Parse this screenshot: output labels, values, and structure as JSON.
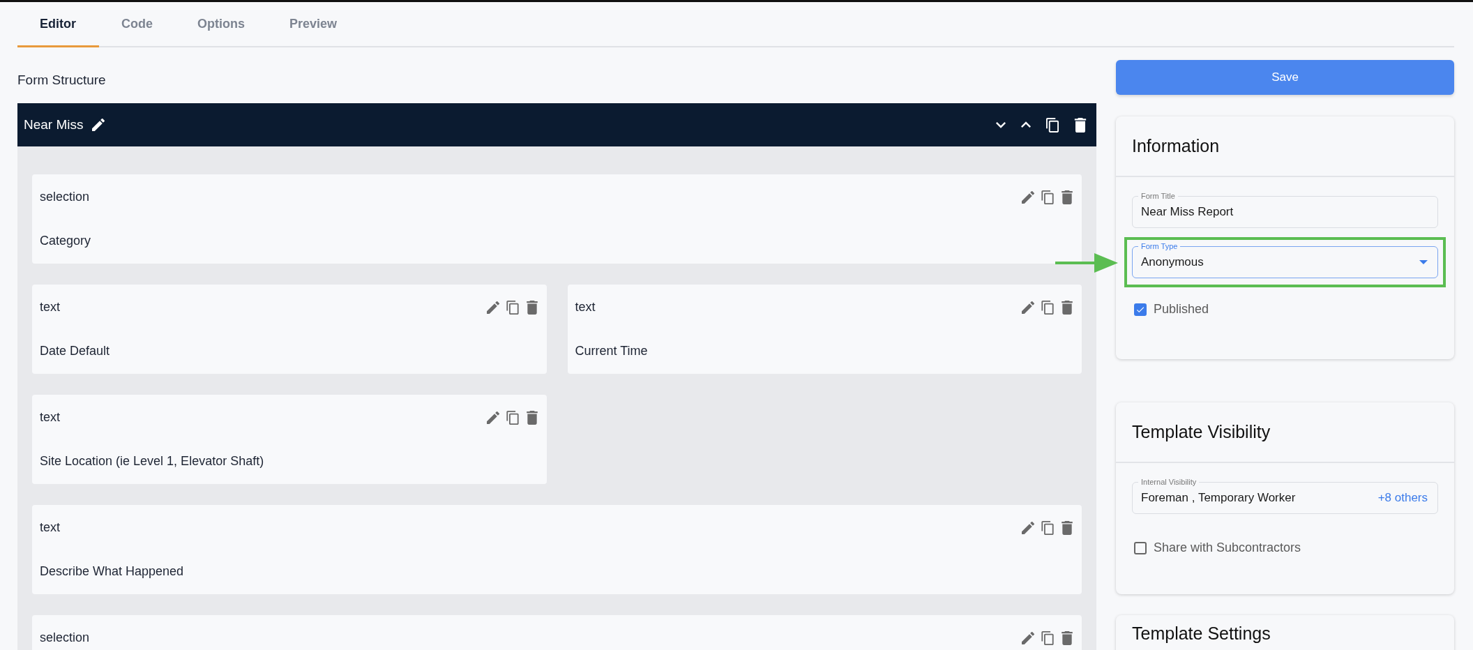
{
  "tabs": [
    {
      "label": "Editor",
      "selected": true
    },
    {
      "label": "Code",
      "selected": false
    },
    {
      "label": "Options",
      "selected": false
    },
    {
      "label": "Preview",
      "selected": false
    }
  ],
  "form_structure": {
    "title": "Form Structure",
    "section": {
      "name": "Near Miss",
      "fields": [
        {
          "type": "selection",
          "label": "Category",
          "kind": "wide"
        },
        {
          "type": "text",
          "label": "Date Default",
          "kind": "narrow"
        },
        {
          "type": "text",
          "label": "Current Time",
          "kind": "narrow"
        },
        {
          "type": "text",
          "label": "Site Location (ie Level 1, Elevator Shaft)",
          "kind": "narrow"
        },
        {
          "type": "text",
          "label": "Describe What Happened",
          "kind": "wide"
        },
        {
          "type": "selection",
          "kind": "wide"
        }
      ]
    }
  },
  "save_button": "Save",
  "information": {
    "title": "Information",
    "form_title": {
      "label": "Form Title",
      "value": "Near Miss Report"
    },
    "form_type": {
      "label": "Form Type",
      "value": "Anonymous",
      "focused": true,
      "highlighted": true
    },
    "published": {
      "label": "Published",
      "checked": true
    }
  },
  "template_visibility": {
    "title": "Template Visibility",
    "internal_visibility": {
      "label": "Internal Visibility",
      "value": "Foreman , Temporary Worker",
      "more": "+8 others"
    },
    "share": {
      "label": "Share with Subcontractors",
      "checked": false
    }
  },
  "template_settings": {
    "title": "Template Settings"
  }
}
